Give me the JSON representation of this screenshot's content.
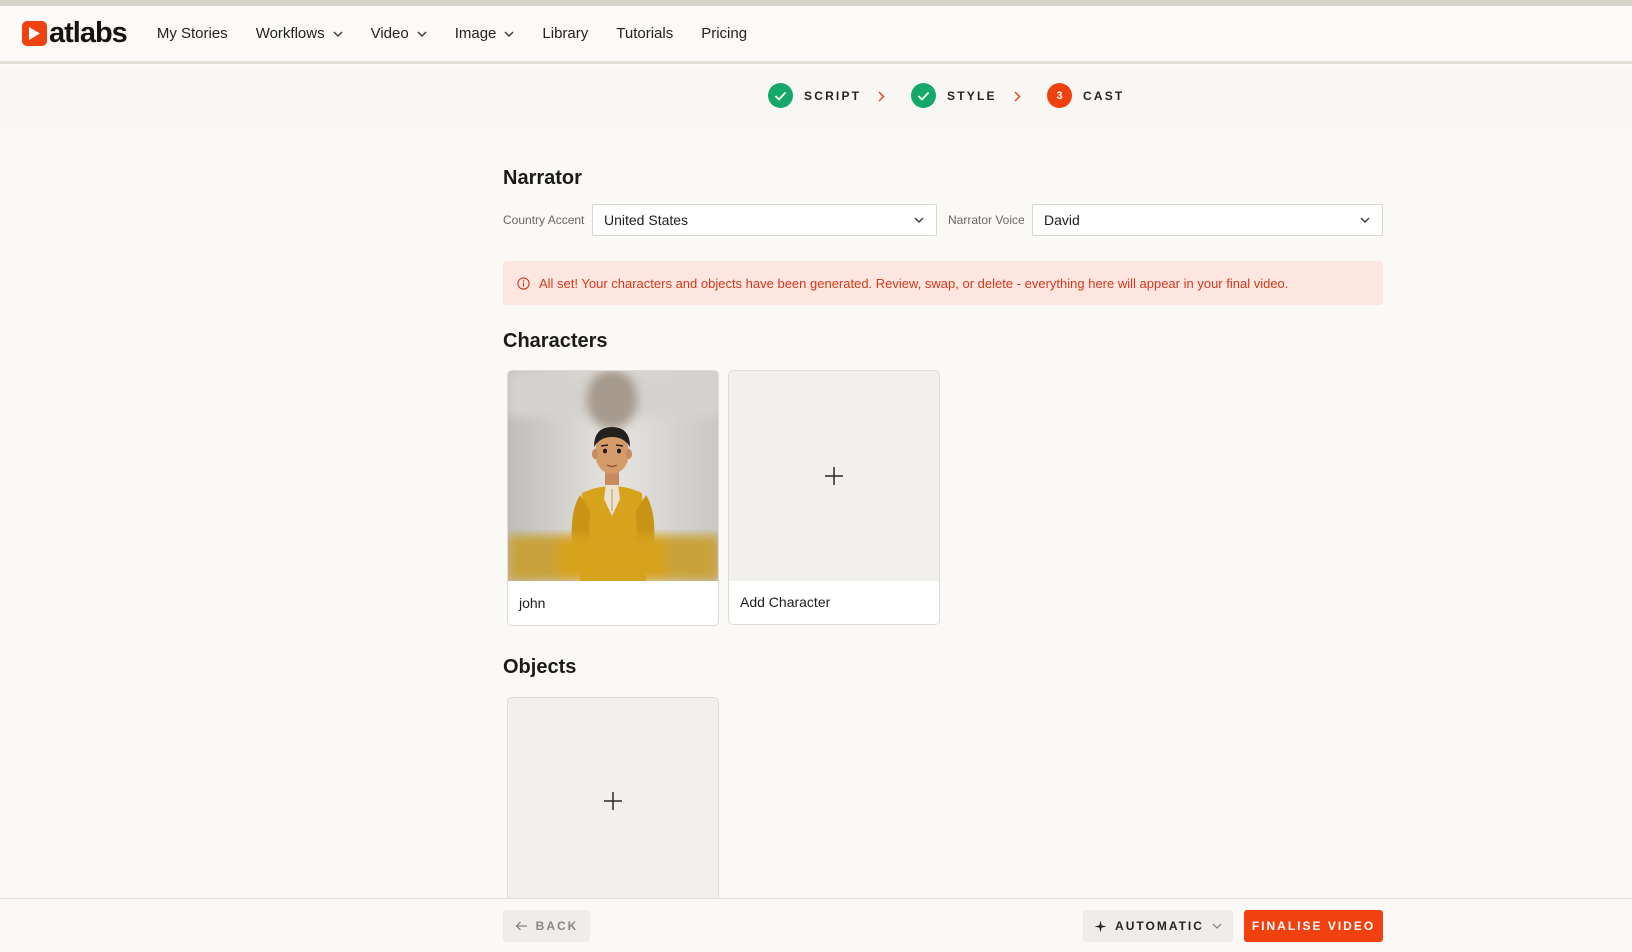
{
  "app": {
    "logo_text": "atlabs",
    "brand_color": "#f0410f"
  },
  "nav": {
    "items": [
      {
        "label": "My Stories",
        "has_dropdown": false
      },
      {
        "label": "Workflows",
        "has_dropdown": true
      },
      {
        "label": "Video",
        "has_dropdown": true
      },
      {
        "label": "Image",
        "has_dropdown": true
      },
      {
        "label": "Library",
        "has_dropdown": false
      },
      {
        "label": "Tutorials",
        "has_dropdown": false
      },
      {
        "label": "Pricing",
        "has_dropdown": false
      }
    ]
  },
  "stepper": {
    "steps": [
      {
        "label": "SCRIPT",
        "status": "done"
      },
      {
        "label": "STYLE",
        "status": "done"
      },
      {
        "label": "CAST",
        "status": "active",
        "number": "3"
      }
    ]
  },
  "narrator": {
    "title": "Narrator",
    "accent_label": "Country Accent",
    "accent_value": "United States",
    "voice_label": "Narrator Voice",
    "voice_value": "David"
  },
  "alert": {
    "icon": "info-icon",
    "text": "All set! Your characters and objects have been generated. Review, swap, or delete - everything here will appear in your final video."
  },
  "characters": {
    "title": "Characters",
    "items": [
      {
        "name": "john"
      }
    ],
    "add_label": "Add Character"
  },
  "objects": {
    "title": "Objects"
  },
  "footer": {
    "back_label": "BACK",
    "mode_label": "AUTOMATIC",
    "finalise_label": "FINALISE VIDEO"
  }
}
